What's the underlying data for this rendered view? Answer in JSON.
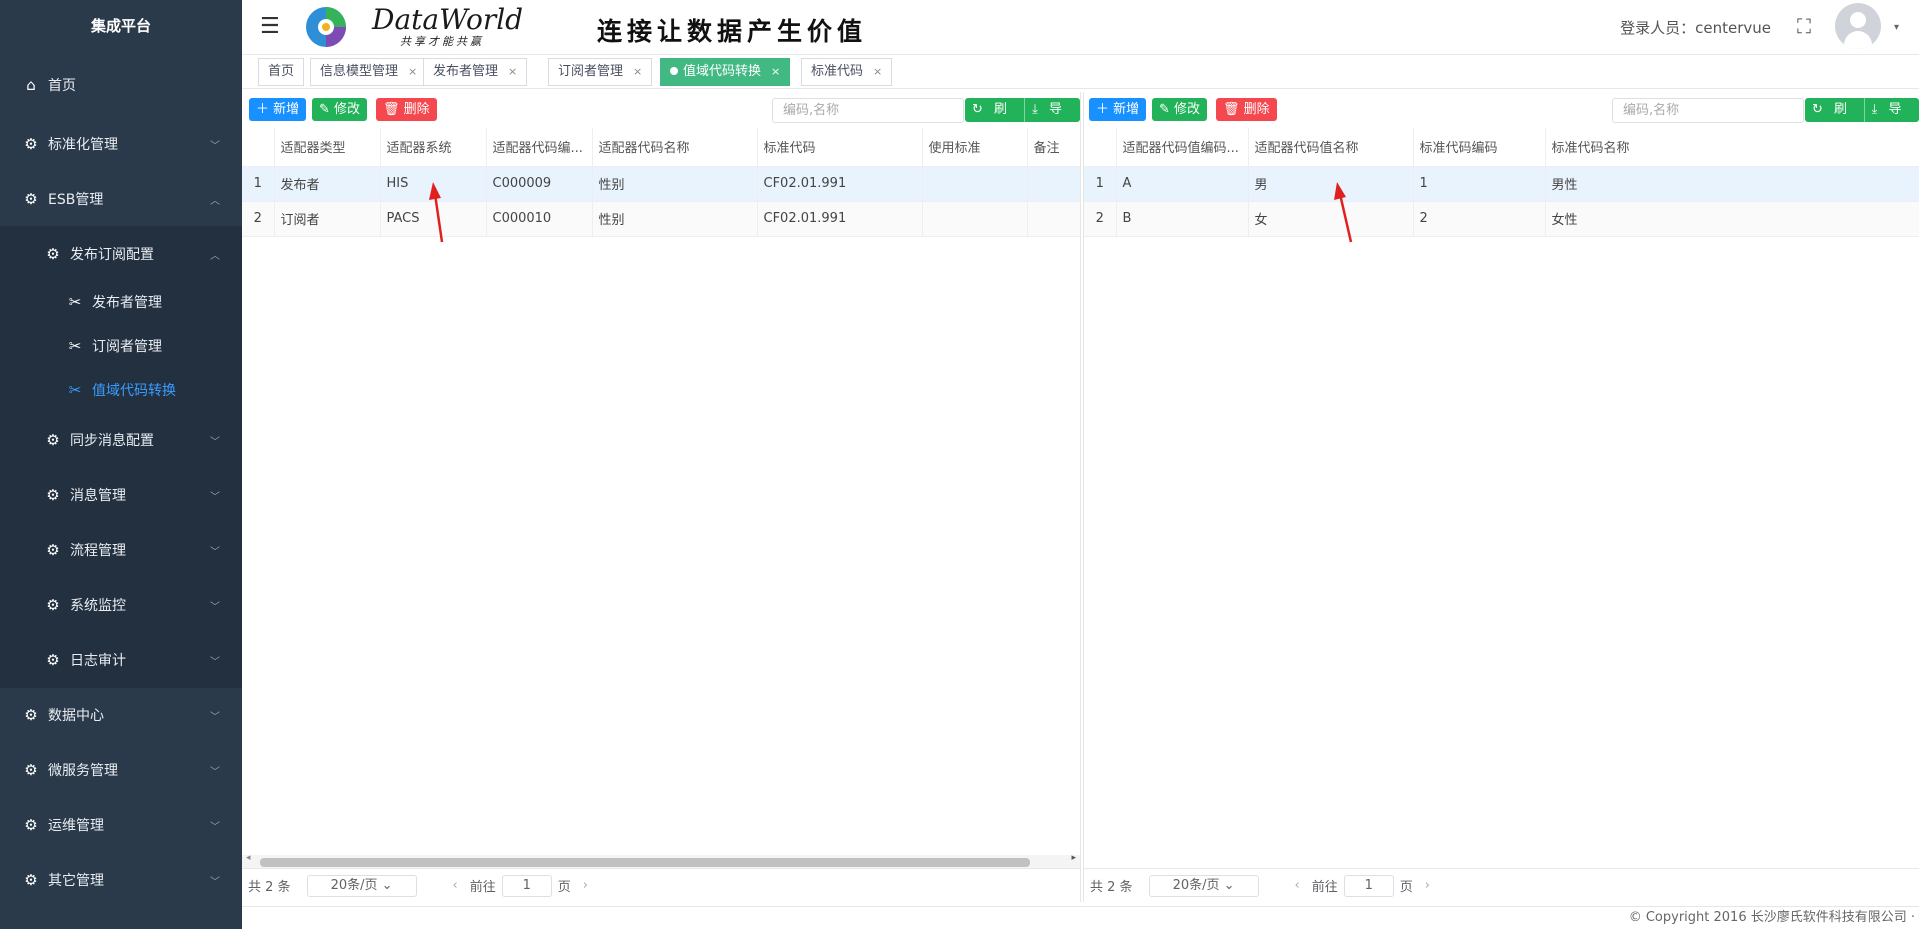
{
  "sidebar": {
    "brand": "集成平台",
    "items": [
      {
        "label": "首页",
        "icon": "home-icon"
      },
      {
        "label": "标准化管理",
        "icon": "gear-icon"
      },
      {
        "label": "ESB管理",
        "icon": "gear-icon"
      },
      {
        "label": "发布订阅配置",
        "icon": "gear-icon"
      },
      {
        "label": "发布者管理",
        "icon": "tools-icon"
      },
      {
        "label": "订阅者管理",
        "icon": "tools-icon"
      },
      {
        "label": "值域代码转换",
        "icon": "tools-icon"
      },
      {
        "label": "同步消息配置",
        "icon": "gear-icon"
      },
      {
        "label": "消息管理",
        "icon": "gear-icon"
      },
      {
        "label": "流程管理",
        "icon": "gear-icon"
      },
      {
        "label": "系统监控",
        "icon": "gear-icon"
      },
      {
        "label": "日志审计",
        "icon": "gear-icon"
      },
      {
        "label": "数据中心",
        "icon": "gear-icon"
      },
      {
        "label": "微服务管理",
        "icon": "gear-icon"
      },
      {
        "label": "运维管理",
        "icon": "gear-icon"
      },
      {
        "label": "其它管理",
        "icon": "gear-icon"
      }
    ]
  },
  "header": {
    "logo_text": "DataWorld",
    "logo_sub": "共享才能共赢",
    "slogan": "连接让数据产生价值",
    "user": "登录人员：centervue"
  },
  "tabs": [
    {
      "label": "首页"
    },
    {
      "label": "信息模型管理"
    },
    {
      "label": "发布者管理"
    },
    {
      "label": "订阅者管理"
    },
    {
      "label": "值域代码转换"
    },
    {
      "label": "标准代码"
    }
  ],
  "toolbar": {
    "add": "新增",
    "edit": "修改",
    "delete": "删除",
    "refresh": "刷新",
    "export": "导出",
    "search_placeholder": "编码,名称"
  },
  "left_table": {
    "columns": [
      "适配器类型",
      "适配器系统",
      "适配器代码编...",
      "适配器代码名称",
      "标准代码",
      "使用标准",
      "备注"
    ],
    "rows": [
      [
        "1",
        "发布者",
        "HIS",
        "C000009",
        "性别",
        "CF02.01.991",
        "",
        ""
      ],
      [
        "2",
        "订阅者",
        "PACS",
        "C000010",
        "性别",
        "CF02.01.991",
        "",
        ""
      ]
    ]
  },
  "right_table": {
    "columns": [
      "适配器代码值编码...",
      "适配器代码值名称",
      "标准代码编码",
      "标准代码名称"
    ],
    "rows": [
      [
        "1",
        "A",
        "男",
        "1",
        "男性"
      ],
      [
        "2",
        "B",
        "女",
        "2",
        "女性"
      ]
    ]
  },
  "pagination": {
    "total": "共 2 条",
    "page_size": "20条/页",
    "goto": "前往",
    "page": "1",
    "page_unit": "页"
  },
  "copyright": "© Copyright 2016 长沙廖氏软件科技有限公司 ·",
  "colors": {
    "sidebar_bg": "#2b3a4a",
    "active_tab": "#42b983",
    "primary": "#1890ff",
    "success": "#22b35a",
    "danger": "#f5484e",
    "arrow": "#e0201f"
  }
}
